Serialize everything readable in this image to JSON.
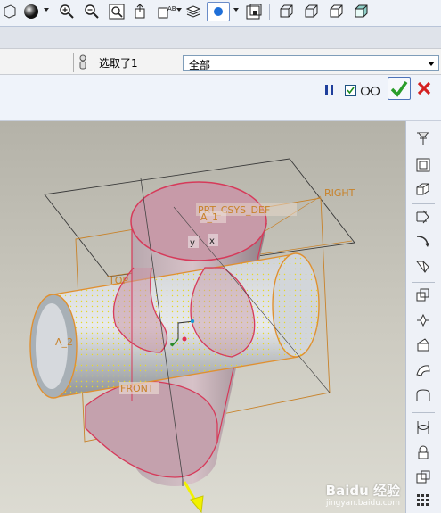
{
  "toolbar": {
    "icons": [
      "shading-icon",
      "zoom-in-icon",
      "zoom-out-icon",
      "refit-icon",
      "orient-icon",
      "named-view-icon",
      "layers-icon",
      "display-style-icon",
      "saved-view-icon",
      "wireframe-icon",
      "hidden-line-icon",
      "no-hidden-icon",
      "shaded-icon"
    ]
  },
  "selection": {
    "label": "选取了1",
    "filter_value": "全部"
  },
  "dashboard": {
    "icons": [
      "pause-icon",
      "preview-checkbox-icon",
      "glasses-icon",
      "confirm-icon",
      "cancel-icon"
    ]
  },
  "model": {
    "labels": {
      "csys": "PRT_CSYS_DEF",
      "right": "RIGHT",
      "top": "TOP",
      "front": "FRONT",
      "axis1": "A_1",
      "axis2": "A_2",
      "y": "y",
      "x": "x"
    }
  },
  "right_tools": {
    "icons": [
      "datum-plane-icon",
      "datum-axis-icon",
      "datum-point-icon",
      "csys-icon",
      "sketch-icon",
      "curve-icon",
      "extrude-icon",
      "revolve-icon",
      "sweep-icon",
      "blend-icon",
      "hole-icon",
      "round-icon",
      "mirror-icon",
      "merge-icon",
      "pattern-icon",
      "trim-icon"
    ]
  },
  "watermark": {
    "brand": "Baidu 经验",
    "url": "jingyan.baidu.com"
  },
  "colors": {
    "confirm": "#2a9d2a",
    "cancel": "#d42020",
    "datum": "#c8822a",
    "surface_edge": "#d63a5a",
    "mesh": "#e6d82a"
  }
}
